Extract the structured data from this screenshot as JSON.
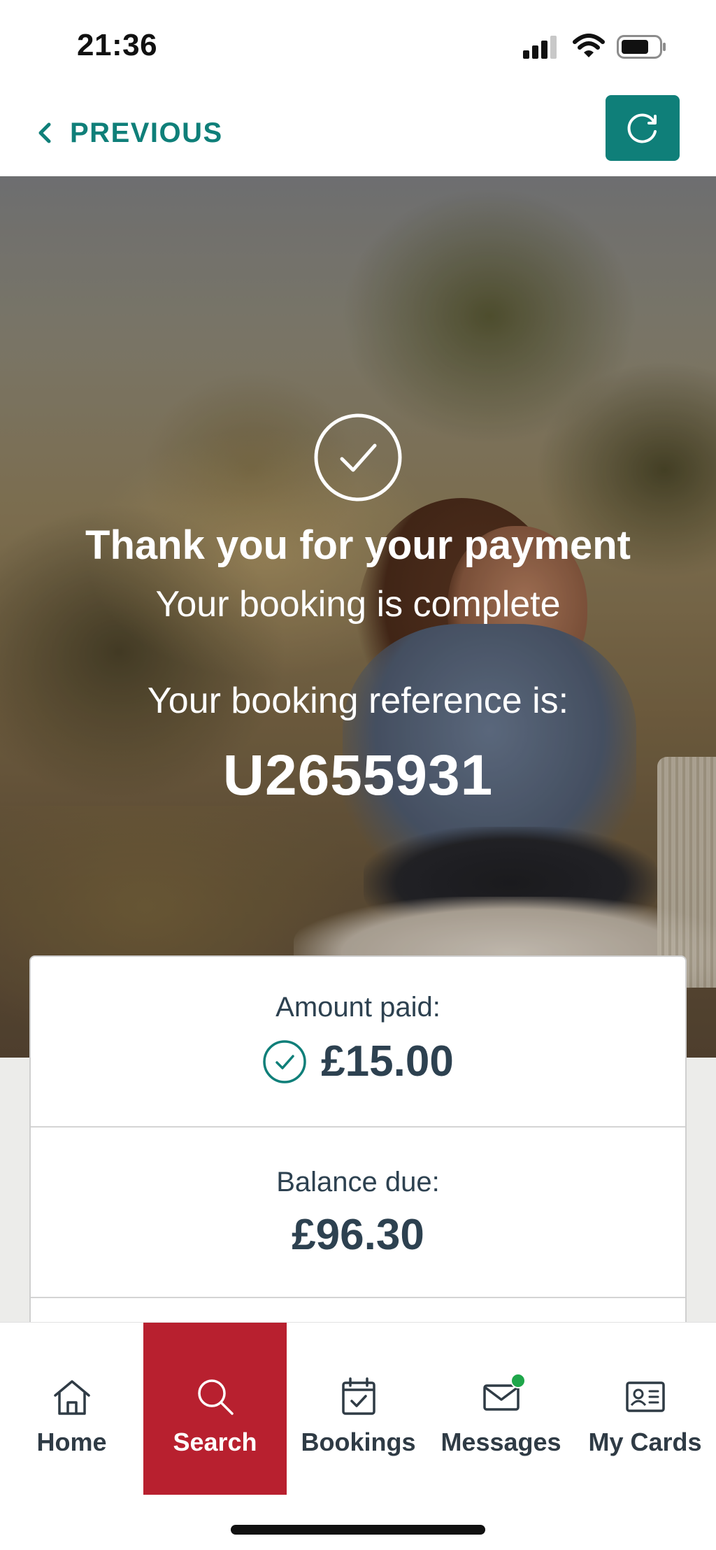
{
  "status_bar": {
    "time": "21:36"
  },
  "header": {
    "previous_label": "PREVIOUS"
  },
  "hero": {
    "title": "Thank you for your payment",
    "subtitle": "Your booking is complete",
    "reference_label": "Your booking reference is:",
    "reference_value": "U2655931"
  },
  "summary": {
    "amount_paid_label": "Amount paid:",
    "amount_paid_value": "£15.00",
    "balance_due_label": "Balance due:",
    "balance_due_value": "£96.30"
  },
  "tab_bar": {
    "active": "Search",
    "items": [
      {
        "label": "Home",
        "icon": "home-icon"
      },
      {
        "label": "Search",
        "icon": "search-icon"
      },
      {
        "label": "Bookings",
        "icon": "calendar-check-icon"
      },
      {
        "label": "Messages",
        "icon": "envelope-icon"
      },
      {
        "label": "My Cards",
        "icon": "id-card-icon"
      }
    ]
  },
  "colors": {
    "brand_teal": "#0f7f79",
    "active_tab_red": "#b8202f",
    "notification_green": "#1ea64a",
    "text_dark": "#2d4150"
  }
}
